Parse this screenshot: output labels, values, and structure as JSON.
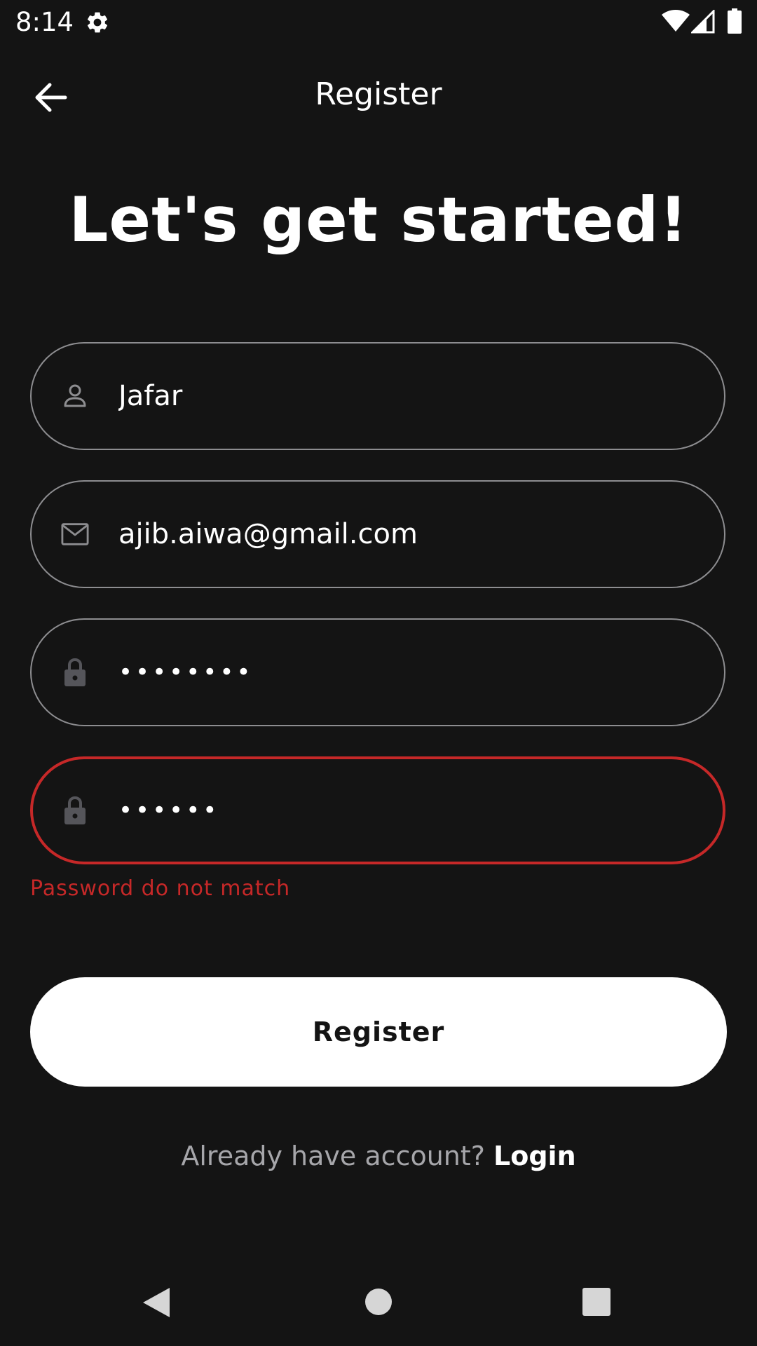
{
  "status_bar": {
    "time": "8:14",
    "icons": [
      "settings-gear-icon",
      "wifi-icon",
      "cell-signal-icon",
      "battery-icon"
    ]
  },
  "top_bar": {
    "back_icon": "arrow-left-icon",
    "title": "Register"
  },
  "headline": "Let's get started!",
  "form": {
    "name": {
      "icon": "person-icon",
      "value": "Jafar"
    },
    "email": {
      "icon": "mail-icon",
      "value": "ajib.aiwa@gmail.com"
    },
    "password": {
      "icon": "lock-icon",
      "value": "••••••••"
    },
    "confirm_password": {
      "icon": "lock-icon",
      "value": "••••••",
      "state": "error"
    },
    "error_message": "Password do not match"
  },
  "register_button": "Register",
  "footer": {
    "prompt": "Already have account? ",
    "login_link": "Login"
  },
  "nav_bar": {
    "icons": [
      "nav-back-icon",
      "nav-home-icon",
      "nav-recents-icon"
    ]
  },
  "colors": {
    "background": "#141414",
    "error": "#c62828",
    "field_border": "#8d8d90",
    "button_bg": "#ffffff",
    "muted_text": "#a6a6aa"
  }
}
